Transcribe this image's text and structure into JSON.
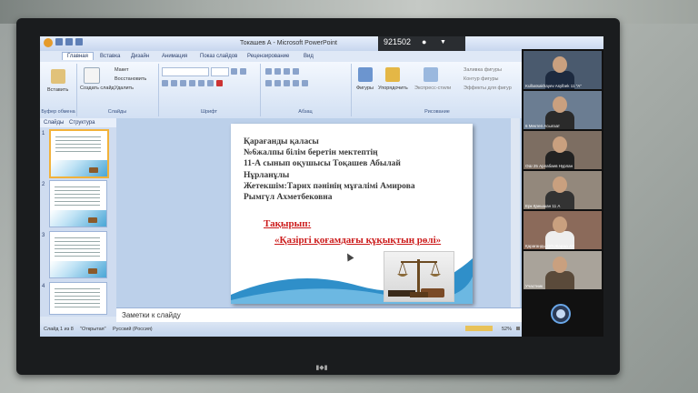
{
  "window": {
    "title": "Токашев А - Microsoft PowerPoint"
  },
  "meeting_overlay": {
    "id": "921502"
  },
  "ribbon_tabs": [
    "Главная",
    "Вставка",
    "Дизайн",
    "Анимация",
    "Показ слайдов",
    "Рецензирование",
    "Вид"
  ],
  "ribbon": {
    "clipboard": {
      "label": "Буфер обмена",
      "paste": "Вставить"
    },
    "slides": {
      "label": "Слайды",
      "new_slide": "Создать слайд",
      "layout": "Макет",
      "reset": "Восстановить",
      "delete": "Удалить"
    },
    "font": {
      "label": "Шрифт"
    },
    "paragraph": {
      "label": "Абзац"
    },
    "drawing": {
      "label": "Рисование",
      "shapes": "Фигуры",
      "arrange": "Упорядочить",
      "quick_styles": "Экспресс-стили",
      "fill": "Заливка фигуры",
      "outline": "Контур фигуры",
      "effects": "Эффекты для фигур"
    }
  },
  "left_pane": {
    "tabs": [
      "Слайды",
      "Структура"
    ],
    "thumb_numbers": [
      "1",
      "2",
      "3",
      "4"
    ]
  },
  "slide": {
    "lines": [
      "Қарағанды қаласы",
      "№6жалпы білім беретін мектептің",
      "11-А сынып оқушысы Тоқашев Абылай",
      "Нұрланұлы",
      "Жетекшім:Тарих пәнінің мұғалімі Амирова",
      "Рымгүл Ахметбековна"
    ],
    "topic_label": "Тақырып:",
    "topic_title": "«Қазіргі қоғамдағы құқықтың рөлі»"
  },
  "notes": {
    "placeholder": "Заметки к слайду"
  },
  "status": {
    "slide_info": "Слайд 1 из 8",
    "theme": "\"Открытая\"",
    "language": "Русский (Россия)",
    "zoom": "52%"
  },
  "participants": [
    {
      "name": "Kulbatsakhayev Asylbek 11 \"А\""
    },
    {
      "name": "6 Мектеп Асылзат"
    },
    {
      "name": "ОШ 25 Арлабаев Нурлан"
    },
    {
      "name": "Ерк Қанышан 11 А"
    },
    {
      "name": "Қарағанды ОП-Жарма АУ"
    },
    {
      "name": "Участник"
    }
  ],
  "colors": {
    "accent": "#cc1b1b",
    "ribbon": "#d2e0f3"
  }
}
